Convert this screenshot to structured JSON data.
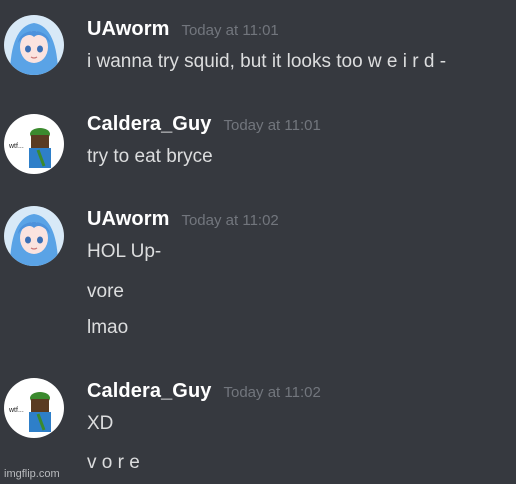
{
  "messages": [
    {
      "username": "UAworm",
      "timestamp": "Today at 11:01",
      "lines": [
        "i wanna try squid, but it looks too w e i r d -"
      ]
    },
    {
      "username": "Caldera_Guy",
      "timestamp": "Today at 11:01",
      "lines": [
        "try to eat bryce"
      ],
      "avatar_text": "wtf..."
    },
    {
      "username": "UAworm",
      "timestamp": "Today at 11:02",
      "lines": [
        "HOL Up-",
        "vore",
        "lmao"
      ]
    },
    {
      "username": "Caldera_Guy",
      "timestamp": "Today at 11:02",
      "lines": [
        "XD",
        "v o r e"
      ],
      "avatar_text": "wtf..."
    }
  ],
  "watermark": "imgflip.com",
  "colors": {
    "background": "#36393f",
    "username": "#ffffff",
    "timestamp": "#72767d",
    "message_text": "#dcddde"
  },
  "icons": {
    "uaworm_avatar": "anime-girl-avatar",
    "caldera_avatar": "green-cap-character-avatar"
  }
}
